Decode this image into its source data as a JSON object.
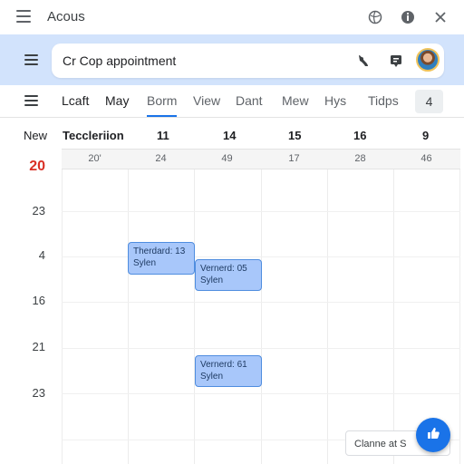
{
  "window": {
    "title": "Acous"
  },
  "search": {
    "query": "Cr Cop appointment"
  },
  "tabs": [
    "Lcaft",
    "May",
    "Borm",
    "View",
    "Dant",
    "Mew",
    "Hys",
    "Tidps"
  ],
  "tab_overflow": "4",
  "header": {
    "left_label": "New",
    "title": "Teccleriion",
    "days": [
      "11",
      "14",
      "15",
      "16",
      "9"
    ]
  },
  "date_row": [
    "20'",
    "24",
    "49",
    "17",
    "28",
    "46"
  ],
  "times": {
    "current": "20",
    "rows": [
      "23",
      "4",
      "16",
      "21",
      "23"
    ]
  },
  "events": [
    {
      "title": "Therdard: 13",
      "sub": "Sylen"
    },
    {
      "title": "Vernerd: 05",
      "sub": "Sylen"
    },
    {
      "title": "Vernerd: 61",
      "sub": "Sylen"
    }
  ],
  "footer": {
    "chip_label": "Clanne at S"
  },
  "colors": {
    "accent": "#1a73e8",
    "band": "#d2e3fc",
    "event_fill": "#a8c7fa",
    "today": "#d93025"
  }
}
